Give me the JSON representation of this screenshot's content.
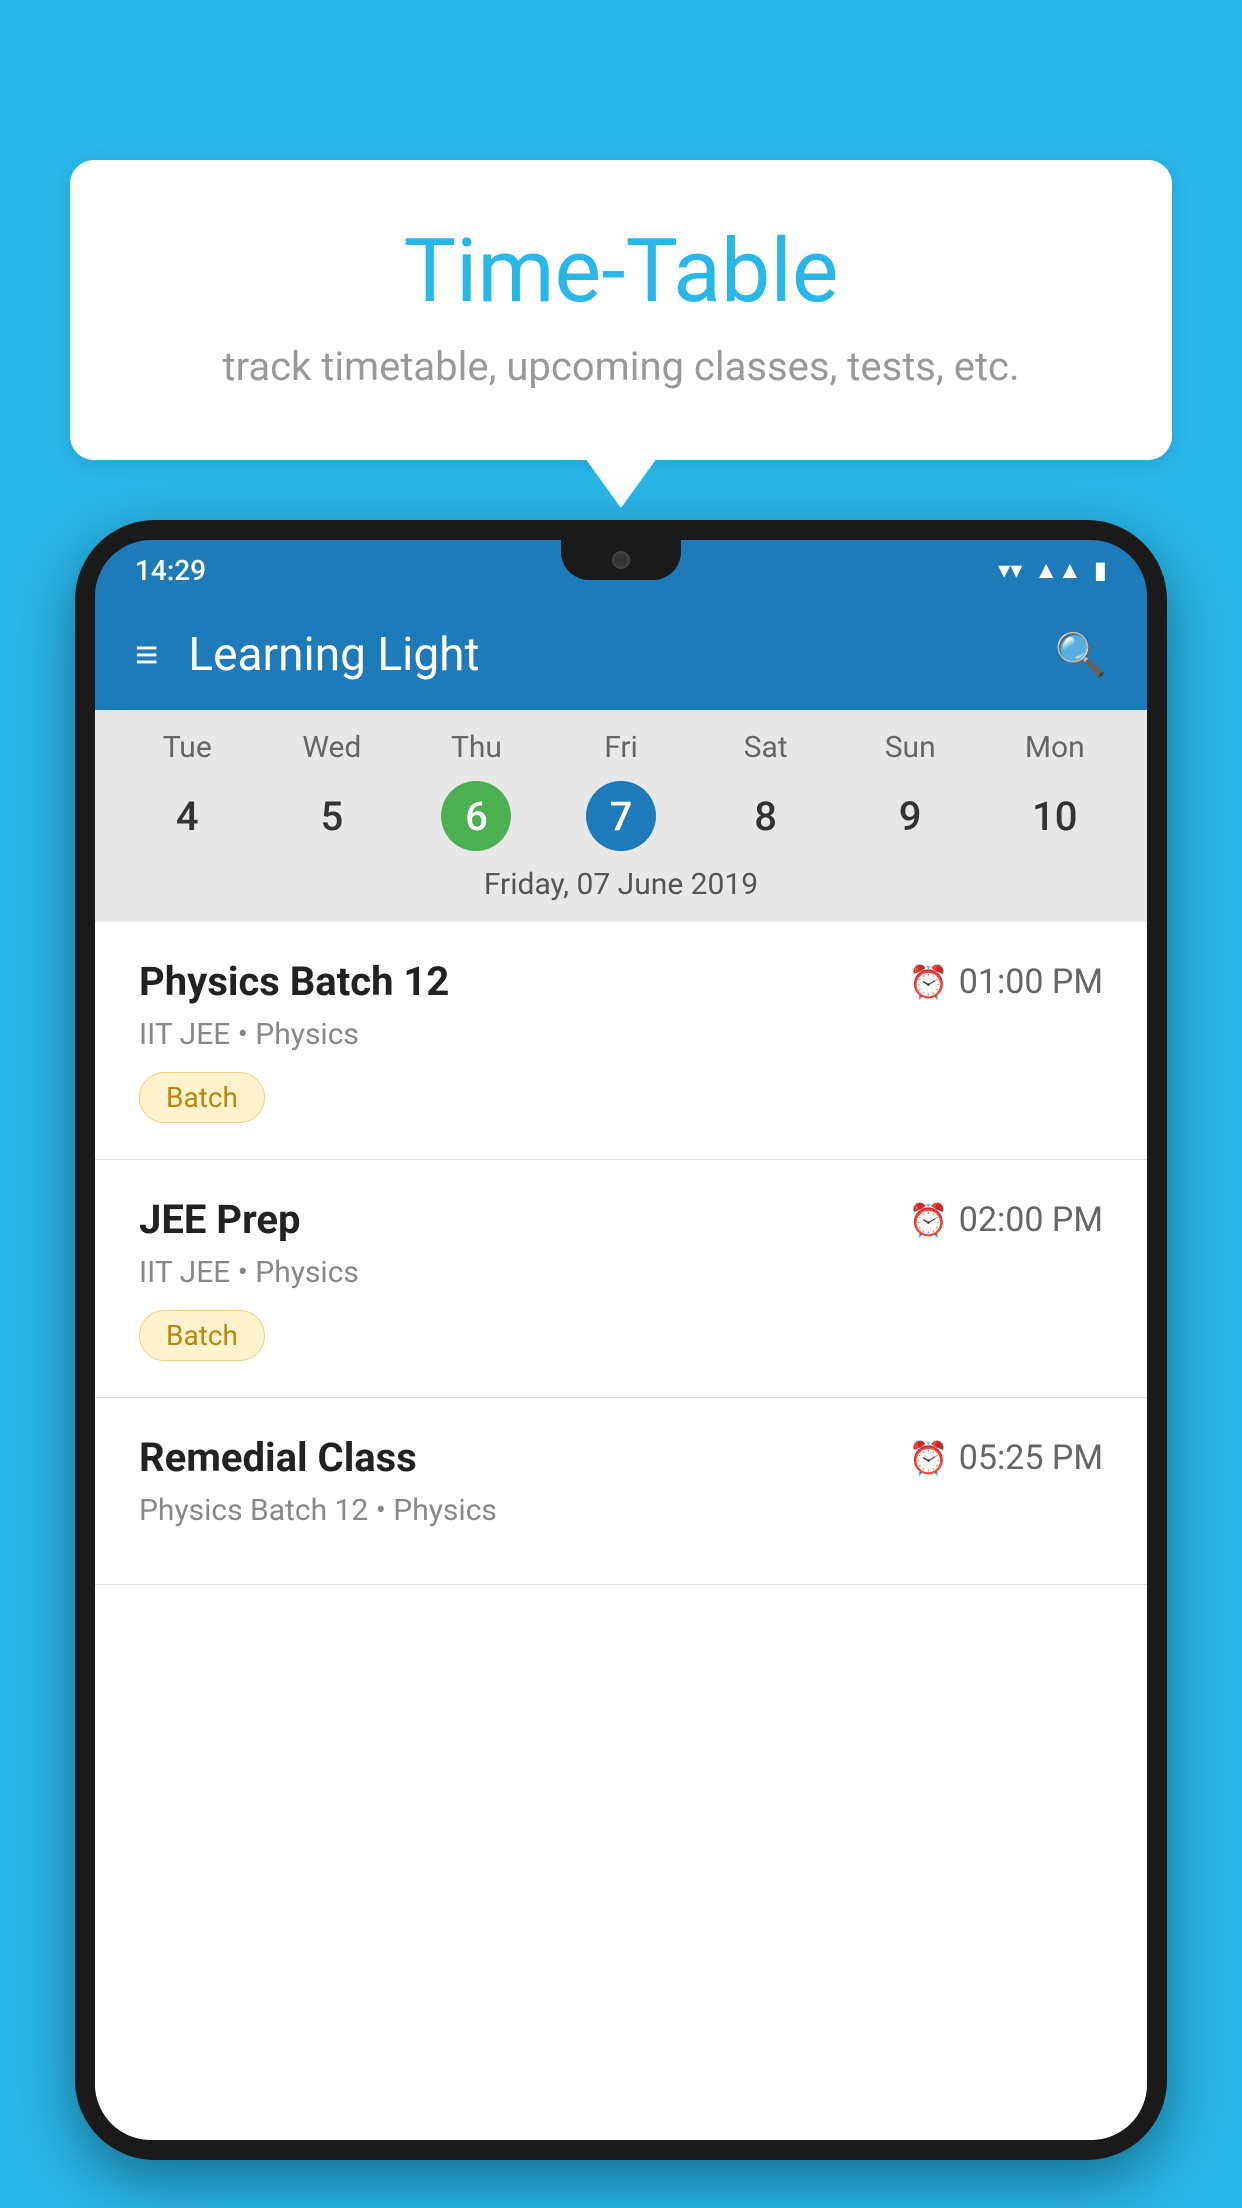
{
  "background_color": "#29b6e8",
  "speech_bubble": {
    "title": "Time-Table",
    "subtitle": "track timetable, upcoming classes, tests, etc."
  },
  "phone": {
    "status_bar": {
      "time": "14:29"
    },
    "app_header": {
      "title": "Learning Light"
    },
    "calendar": {
      "days": [
        {
          "name": "Tue",
          "number": "4",
          "state": "normal"
        },
        {
          "name": "Wed",
          "number": "5",
          "state": "normal"
        },
        {
          "name": "Thu",
          "number": "6",
          "state": "today"
        },
        {
          "name": "Fri",
          "number": "7",
          "state": "selected"
        },
        {
          "name": "Sat",
          "number": "8",
          "state": "normal"
        },
        {
          "name": "Sun",
          "number": "9",
          "state": "normal"
        },
        {
          "name": "Mon",
          "number": "10",
          "state": "normal"
        }
      ],
      "selected_date_label": "Friday, 07 June 2019"
    },
    "schedule_items": [
      {
        "name": "Physics Batch 12",
        "time": "01:00 PM",
        "meta": "IIT JEE • Physics",
        "badge": "Batch"
      },
      {
        "name": "JEE Prep",
        "time": "02:00 PM",
        "meta": "IIT JEE • Physics",
        "badge": "Batch"
      },
      {
        "name": "Remedial Class",
        "time": "05:25 PM",
        "meta": "Physics Batch 12 • Physics",
        "badge": null
      }
    ]
  }
}
